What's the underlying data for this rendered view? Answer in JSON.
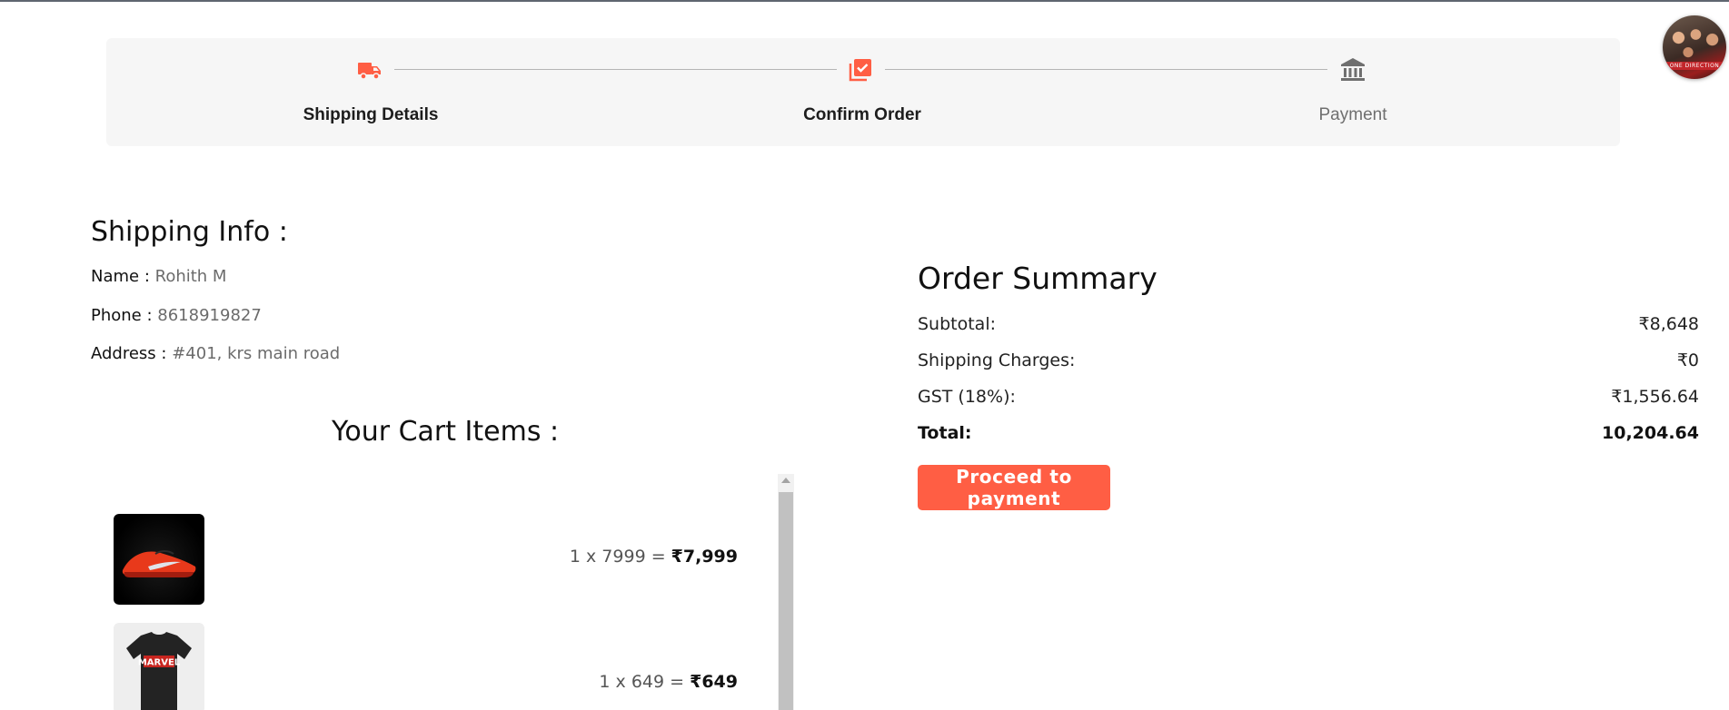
{
  "stepper": {
    "steps": [
      {
        "label": "Shipping Details",
        "icon": "truck-icon",
        "state": "done"
      },
      {
        "label": "Confirm Order",
        "icon": "checklist-icon",
        "state": "done"
      },
      {
        "label": "Payment",
        "icon": "bank-icon",
        "state": "pending"
      }
    ],
    "active_color": "#ff5e44",
    "pending_color": "#6f6f6f"
  },
  "avatar": {
    "caption": "ONE DIRECTION"
  },
  "shipping": {
    "title": "Shipping Info :",
    "name_label": "Name :",
    "name_value": "Rohith M",
    "phone_label": "Phone :",
    "phone_value": "8618919827",
    "address_label": "Address :",
    "address_value": "#401, krs main road"
  },
  "cart": {
    "title": "Your Cart Items :",
    "items": [
      {
        "image": "red-sneaker",
        "qty_line": "1 x 7999 =",
        "total": "₹7,999"
      },
      {
        "image": "black-marvel-tshirt",
        "qty_line": "1 x 649 =",
        "total": "₹649"
      }
    ]
  },
  "summary": {
    "title": "Order Summary",
    "subtotal_label": "Subtotal:",
    "subtotal_value": "₹8,648",
    "shipping_label": "Shipping Charges:",
    "shipping_value": "₹0",
    "gst_label": "GST (18%):",
    "gst_value": "₹1,556.64",
    "total_label": "Total:",
    "total_value": "10,204.64",
    "pay_button": "Proceed to payment",
    "button_color": "#ff5e44"
  }
}
